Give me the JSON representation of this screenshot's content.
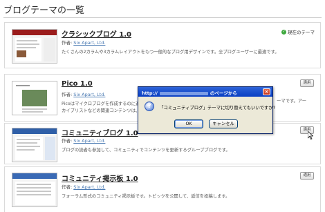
{
  "page": {
    "title": "ブログテーマの一覧"
  },
  "themes": [
    {
      "name": "クラシックブログ 1.0",
      "author_label": "作者:",
      "author": "Six Apart, Ltd.",
      "description": "たくさんの2カラムや3カラムレイアウトをもつ一般的なブログ用デザインです。全ブログユーザーに最適です。",
      "description2": "",
      "current_label": "現在のテーマ"
    },
    {
      "name": "Pico 1.0",
      "author_label": "作者:",
      "author": "Six Apart, Ltd.",
      "description": "Picoはマイクロブログを作成するのに適し",
      "description2": "カイブリストなどの関連コンテンツは、メイ",
      "description_tail": "ーマです。アー",
      "apply_label": "適用"
    },
    {
      "name": "コミュニティブログ 1.0",
      "author_label": "作者:",
      "author": "Six Apart, Ltd.",
      "description": "ブログの読者も参加して、コミュニティでコンテンツを更新するグループブログです。",
      "apply_label": "適用"
    },
    {
      "name": "コミュニティ掲示板 1.0",
      "author_label": "作者:",
      "author": "Six Apart, Ltd.",
      "description": "フォーラム形式のコミュニティ掲示板です。トピックを公開して、返信を投稿します。",
      "apply_label": "適用"
    }
  ],
  "dialog": {
    "title_prefix": "http://",
    "title_suffix": "のページから",
    "close": "×",
    "icon": "?",
    "message": "「コミュニティブログ」テーマに切り替えてもいいですか?",
    "ok_label": "OK",
    "cancel_label": "キャンセル"
  },
  "colors": {
    "titlebar": "#0a3fc3",
    "dialog_bg": "#ece9d8",
    "link": "#4a7ab3",
    "check": "#3da83d"
  }
}
